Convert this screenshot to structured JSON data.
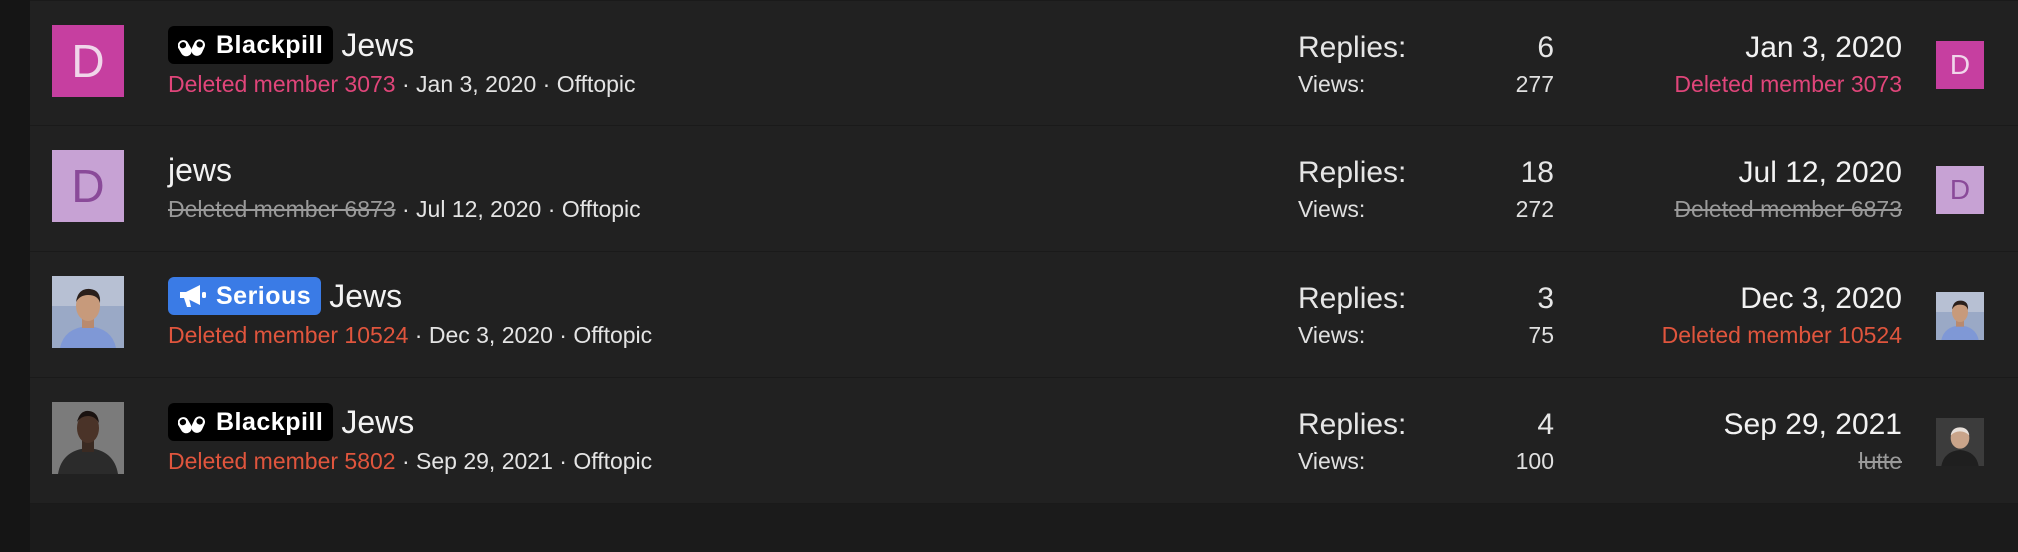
{
  "colors": {
    "avatar_d_magenta": "#c63fa0",
    "avatar_d_lilac": "#c7a2d4",
    "author_red": "#e0553d",
    "author_pink": "#e0457a",
    "badge_serious": "#3a7be6",
    "badge_blackpill": "#000000"
  },
  "labels": {
    "replies": "Replies:",
    "views": "Views:"
  },
  "threads": [
    {
      "avatar_letter": "D",
      "badge": {
        "text": "Blackpill",
        "icon": "pills-icon"
      },
      "title": "Jews",
      "author": "Deleted member 3073",
      "date": "Jan 3, 2020",
      "forum": "Offtopic",
      "replies": "6",
      "views": "277",
      "last_date": "Jan 3, 2020",
      "last_user": "Deleted member 3073",
      "last_avatar_letter": "D"
    },
    {
      "avatar_letter": "D",
      "title": "jews",
      "author": "Deleted member 6873",
      "date": "Jul 12, 2020",
      "forum": "Offtopic",
      "replies": "18",
      "views": "272",
      "last_date": "Jul 12, 2020",
      "last_user": "Deleted member 6873",
      "last_avatar_letter": "D"
    },
    {
      "badge": {
        "text": "Serious",
        "icon": "megaphone-icon"
      },
      "title": "Jews",
      "author": "Deleted member 10524",
      "date": "Dec 3, 2020",
      "forum": "Offtopic",
      "replies": "3",
      "views": "75",
      "last_date": "Dec 3, 2020",
      "last_user": "Deleted member 10524"
    },
    {
      "badge": {
        "text": "Blackpill",
        "icon": "pills-icon"
      },
      "title": "Jews",
      "author": "Deleted member 5802",
      "date": "Sep 29, 2021",
      "forum": "Offtopic",
      "replies": "4",
      "views": "100",
      "last_date": "Sep 29, 2021",
      "last_user": "lutte"
    }
  ]
}
